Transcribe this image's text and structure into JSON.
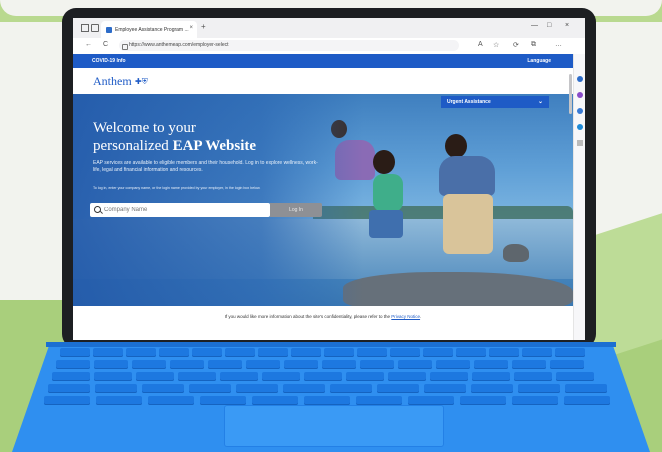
{
  "browser": {
    "tab_title": "Employee Assistance Program ...",
    "tab_close": "×",
    "new_tab": "+",
    "url": "https://www.anthemeap.com/employer-select",
    "nav_back": "←",
    "nav_refresh": "C",
    "win_min": "—",
    "win_max": "□",
    "win_close": "×",
    "tools": [
      "A",
      "☆",
      "⟳",
      "⧉",
      "…"
    ]
  },
  "page": {
    "covid_link": "COVID-19 Info",
    "language_link": "Language",
    "logo_text": "Anthem",
    "urgent_assistance": "Urgent Assistance",
    "hero": {
      "headline_line1": "Welcome to your",
      "headline_line2_prefix": "personalized ",
      "headline_line2_bold": "EAP Website",
      "subtext": "EAP services are available to eligible members and their household. Log in to explore wellness, work-life, legal and financial information and resources.",
      "instruction": "To log in, enter your company name, or the login name provided by your employer, in the login box below."
    },
    "search": {
      "placeholder": "Company Name",
      "login_label": "Log In"
    },
    "footer": {
      "text": "If you would like more information about the site's confidentiality, please refer to the ",
      "link": "Privacy Notice",
      "tail": "."
    }
  },
  "colors": {
    "brand_blue": "#1e5bc6",
    "keyboard_blue": "#2f8ff0",
    "background_green": "#a9cf7c"
  }
}
